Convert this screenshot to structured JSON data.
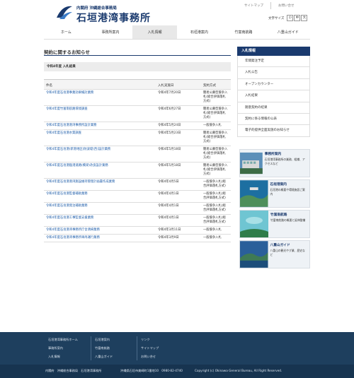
{
  "header": {
    "org_sub": "内閣府 沖縄総合事務局",
    "org_main": "石垣港湾事務所",
    "util_links": [
      "サイトマップ",
      "お問い合せ"
    ],
    "fontsize_label": "文字サイズ",
    "fontsize_options": [
      "小",
      "中",
      "大"
    ]
  },
  "nav": {
    "items": [
      "ホーム",
      "事務所案内",
      "入札情報",
      "石垣港案内",
      "竹富南航路",
      "八重山ガイド"
    ],
    "active_index": 2
  },
  "main": {
    "page_title": "契約に関するお知らせ",
    "section_title": "令和4年度 入札結果",
    "table": {
      "headers": [
        "件名",
        "入札実施日",
        "契約方式"
      ],
      "rows": [
        {
          "name": "令和4年度石垣港事業効果検討業務",
          "date": "令和4年7月20日",
          "method": "簡易公募型競争入札(総合評価落札方式)"
        },
        {
          "name": "令和4年度竹富南航路環境調査",
          "date": "令和4年6月27日",
          "method": "簡易公募型競争入札(総合評価落札方式)"
        },
        {
          "name": "令和4年度石垣港港湾事務所設計業務",
          "date": "令和4年5月24日",
          "method": "一般競争入札"
        },
        {
          "name": "令和4年度石垣港水質調査",
          "date": "令和4年5月23日",
          "method": "簡易公募型競争入札(総合評価落札方式)"
        },
        {
          "name": "令和4年度石垣港(新港地区)防波堤(西)設計業務",
          "date": "令和4年5月18日",
          "method": "簡易公募型競争入札(総合評価落札方式)"
        },
        {
          "name": "令和4年度石垣港臨港道路(橋梁)改良設計業務",
          "date": "令和4年5月18日",
          "method": "簡易公募型競争入札(総合評価落札方式)"
        },
        {
          "name": "令和4年度石垣港港湾施設維持管理計画書作成業務",
          "date": "令和4年4月5日",
          "method": "一般競争入札(総合評価落札方式)"
        },
        {
          "name": "令和4年度石垣港監督補助業務",
          "date": "令和4年4月1日",
          "method": "一般競争入札(総合評価落札方式)"
        },
        {
          "name": "令和4年度石垣港発注補助業務",
          "date": "令和4年4月1日",
          "method": "一般競争入札(総合評価落札方式)"
        },
        {
          "name": "令和4年度石垣港工事監督支援業務",
          "date": "令和4年4月1日",
          "method": "一般競争入札(総合評価落札方式)"
        },
        {
          "name": "令和4年度石垣港湾事務所庁舎清掃業務",
          "date": "令和4年3月11日",
          "method": "一般競争入札"
        },
        {
          "name": "令和4年度石垣港湾事務所車両運行業務",
          "date": "令和4年3月9日",
          "method": "一般競争入札"
        }
      ]
    }
  },
  "sidebar": {
    "title": "入札情報",
    "items": [
      "年間発注予定",
      "入札公告",
      "オープンカウンター",
      "入札結果",
      "随意契約の結果",
      "契約に係る情報の公表",
      "電子的提供全面実施のお知らせ"
    ],
    "banners": [
      {
        "title": "事務所案内",
        "desc": "石垣港湾事務所の業務、組織、アクセスなど"
      },
      {
        "title": "石垣港案内",
        "desc": "石垣港の概要や環境施設ご案内"
      },
      {
        "title": "竹富南航路",
        "desc": "竹富南航路の概要と延伸整備"
      },
      {
        "title": "八重山ガイド",
        "desc": "八重山の観光やグ業、歴史など"
      }
    ]
  },
  "footer": {
    "col1": [
      "石垣港湾事務所ホーム",
      "事務所案内",
      "入札情報"
    ],
    "col2": [
      "石垣港案内",
      "竹富南航路",
      "八重山ガイド"
    ],
    "col3": [
      "リンク",
      "サイトマップ",
      "お問い合せ"
    ],
    "bottom_org": "内閣府　沖縄総合事務局　石垣港湾事務所",
    "address": "沖縄県石垣市美崎町1番地10　0980-82-4740",
    "copyright": "Copyright (c) Okinawa General Bureau, All Right Reserved."
  },
  "colors": {
    "brand": "#1a3a6e",
    "link": "#1a5aa8",
    "footer": "#1e3f5e"
  }
}
